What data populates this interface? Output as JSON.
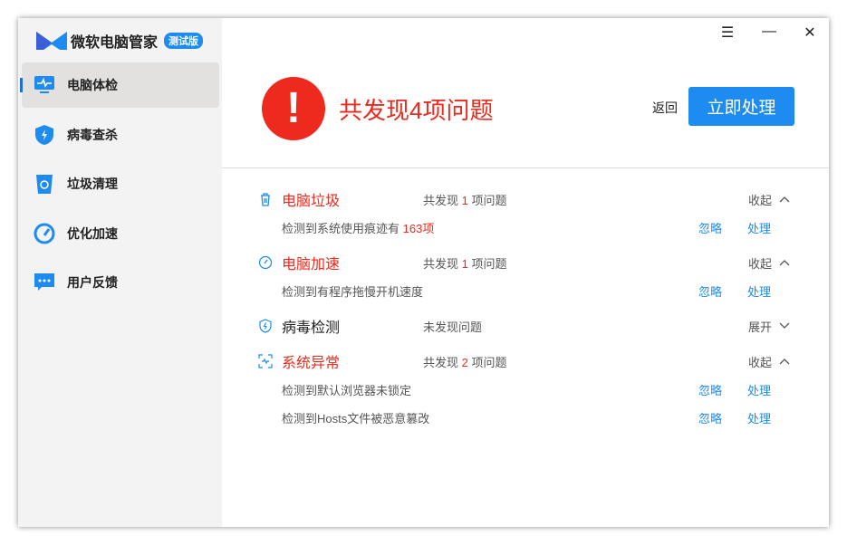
{
  "app": {
    "title": "微软电脑管家",
    "badge": "测试版"
  },
  "sidebar": {
    "items": [
      {
        "label": "电脑体检",
        "icon": "monitor-pulse-icon"
      },
      {
        "label": "病毒查杀",
        "icon": "shield-icon"
      },
      {
        "label": "垃圾清理",
        "icon": "recycle-bin-icon"
      },
      {
        "label": "优化加速",
        "icon": "speedometer-icon"
      },
      {
        "label": "用户反馈",
        "icon": "chat-icon"
      }
    ]
  },
  "window": {
    "menu": "☰",
    "minimize": "—",
    "close": "✕"
  },
  "header": {
    "alert_symbol": "!",
    "title": "共发现4项问题",
    "back_label": "返回",
    "action_label": "立即处理"
  },
  "colors": {
    "accent": "#1e8bf0",
    "danger": "#ee2a1e"
  },
  "categories": [
    {
      "name": "电脑垃圾",
      "summary_pre": "共发现 ",
      "count": "1",
      "summary_post": " 项问题",
      "toggle": "收起",
      "details": [
        {
          "text": "检测到系统使用痕迹有 ",
          "highlight": "163项"
        }
      ]
    },
    {
      "name": "电脑加速",
      "summary_pre": "共发现 ",
      "count": "1",
      "summary_post": " 项问题",
      "toggle": "收起",
      "details": [
        {
          "text": "检测到有程序拖慢开机速度",
          "highlight": ""
        }
      ]
    },
    {
      "name": "病毒检测",
      "summary_pre": "未发现问题",
      "toggle": "展开"
    },
    {
      "name": "系统异常",
      "summary_pre": "共发现 ",
      "count": "2",
      "summary_post": " 项问题",
      "toggle": "收起",
      "details": [
        {
          "text": "检测到默认浏览器未锁定",
          "highlight": ""
        },
        {
          "text": "检测到Hosts文件被恶意篡改",
          "highlight": ""
        }
      ]
    }
  ],
  "actions": {
    "ignore": "忽略",
    "handle": "处理"
  }
}
